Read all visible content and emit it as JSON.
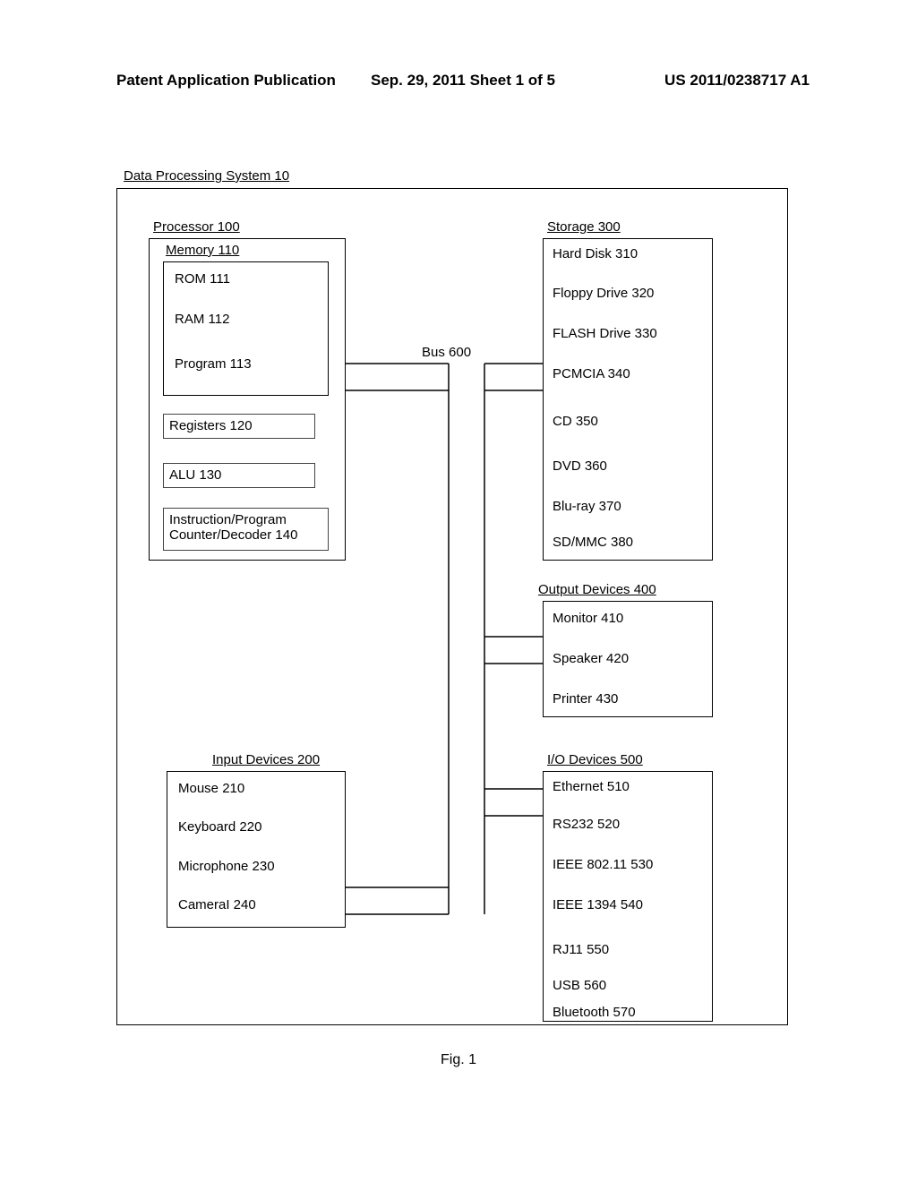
{
  "header": {
    "left": "Patent Application Publication",
    "center": "Sep. 29, 2011   Sheet 1 of 5",
    "right": "US 2011/0238717 A1"
  },
  "system": {
    "title": "Data Processing System 10"
  },
  "processor": {
    "title": "Processor 100",
    "memory_title": "Memory 110",
    "rom": "ROM 111",
    "ram": "RAM 112",
    "program": "Program 113",
    "registers": "Registers 120",
    "alu": "ALU 130",
    "counter": "Instruction/Program Counter/Decoder 140"
  },
  "storage": {
    "title": "Storage 300",
    "items": {
      "hd": "Hard Disk 310",
      "floppy": "Floppy Drive 320",
      "flash": "FLASH Drive 330",
      "pcmcia": "PCMCIA 340",
      "cd": "CD 350",
      "dvd": "DVD 360",
      "bluray": "Blu-ray 370",
      "sd": "SD/MMC 380"
    }
  },
  "output": {
    "title": "Output Devices 400",
    "monitor": "Monitor 410",
    "speaker": "Speaker 420",
    "printer": "Printer 430"
  },
  "input": {
    "title": "Input Devices 200",
    "mouse": "Mouse 210",
    "keyboard": "Keyboard 220",
    "microphone": "Microphone 230",
    "camera": "CameraI 240"
  },
  "io": {
    "title": "I/O Devices 500",
    "ethernet": "Ethernet 510",
    "rs232": "RS232 520",
    "wifi": "IEEE 802.11 530",
    "firewire": "IEEE 1394 540",
    "rj11": "RJ11 550",
    "usb": "USB 560",
    "bluetooth": "Bluetooth 570"
  },
  "bus": "Bus 600",
  "figure_label": "Fig. 1"
}
